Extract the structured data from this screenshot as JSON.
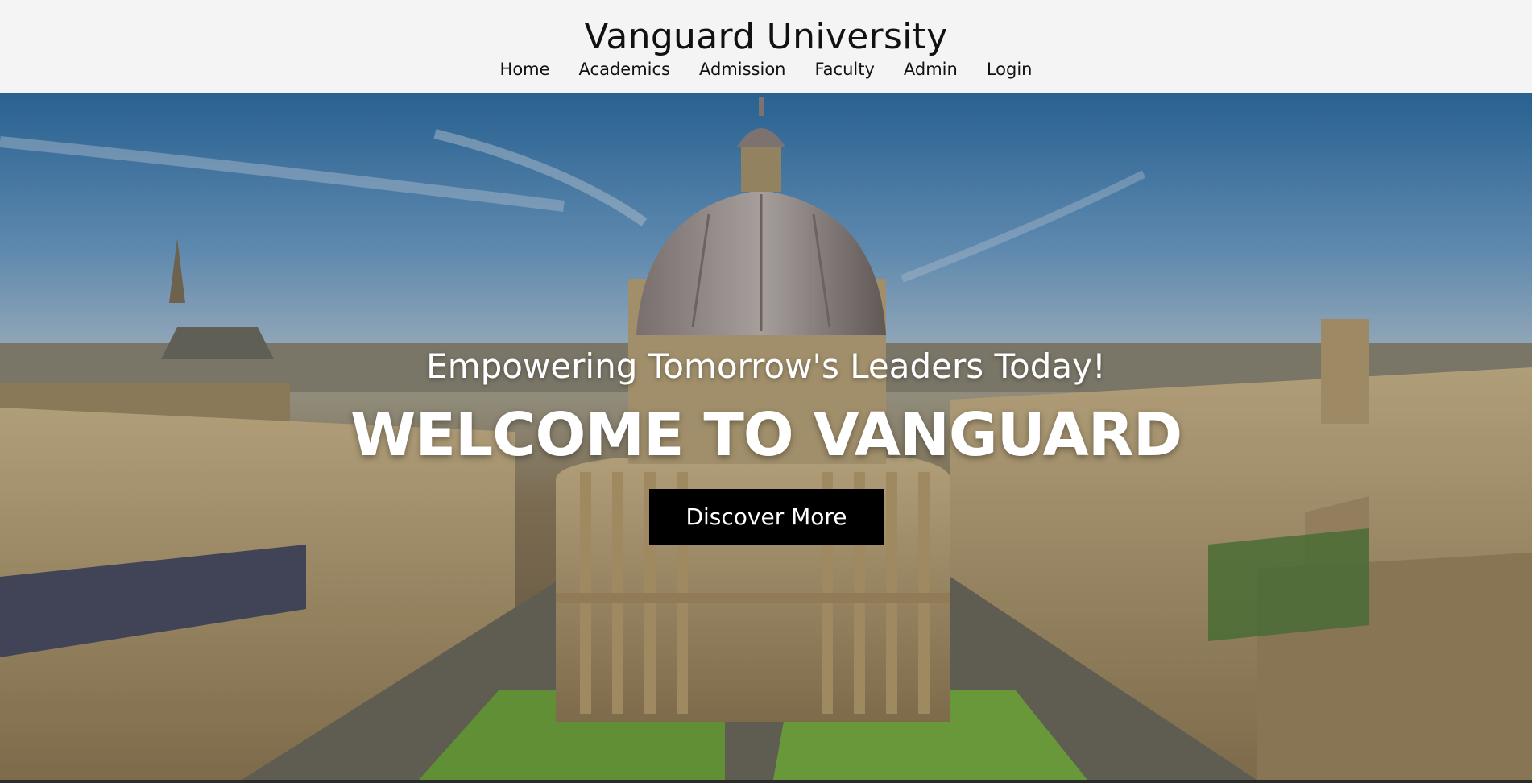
{
  "header": {
    "title": "Vanguard University",
    "nav": [
      {
        "label": "Home"
      },
      {
        "label": "Academics"
      },
      {
        "label": "Admission"
      },
      {
        "label": "Faculty"
      },
      {
        "label": "Admin"
      },
      {
        "label": "Login"
      }
    ]
  },
  "hero": {
    "tagline": "Empowering Tomorrow's  Leaders Today!",
    "headline": "WELCOME TO VANGUARD",
    "cta_label": "Discover More",
    "image_subject": "aerial view of domed university library and historic campus buildings"
  },
  "colors": {
    "header_bg": "#f4f4f4",
    "cta_bg": "#000000",
    "hero_text": "#ffffff"
  }
}
